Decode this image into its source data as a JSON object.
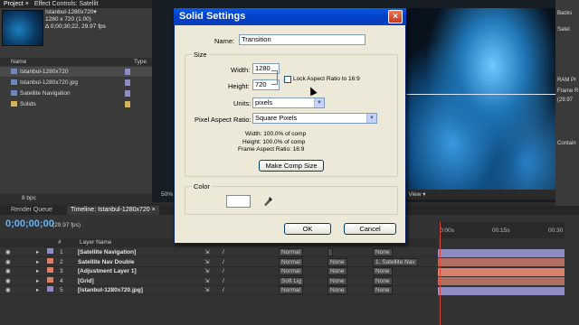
{
  "project_panel": {
    "tabs": [
      "Project ×",
      "Effect Controls: Satellit"
    ],
    "item_title": "Istanbul-1280x720▾",
    "item_size": "1280 x 720 (1.00)",
    "item_duration": "Δ 0;00;30;22, 29.97 fps",
    "column_name": "Name",
    "column_type": "Type",
    "items": [
      {
        "label": "Istanbul-1280x720",
        "icon": "comp-icon",
        "color": "#8e8ec2"
      },
      {
        "label": "Istanbul-1280x720.jpg",
        "icon": "image-icon",
        "color": "#8e8ec2"
      },
      {
        "label": "Satellite Navigation",
        "icon": "comp-icon",
        "color": "#8e8ec2"
      },
      {
        "label": "Solids",
        "icon": "folder-icon",
        "color": "#d2b35a"
      }
    ],
    "bpc": "8 bpc"
  },
  "right_panel": {
    "items": [
      "Backs",
      "Satel",
      "RAM Pr",
      "Frame R",
      "(29.97",
      "Contain"
    ]
  },
  "viewer": {
    "footer_zoom": "50%",
    "footer_view": "1 View ▾"
  },
  "dialog": {
    "title": "Solid Settings",
    "name_label": "Name:",
    "name_value": "Transition",
    "size_group": "Size",
    "width_label": "Width:",
    "width_value": "1280",
    "height_label": "Height:",
    "height_value": "720",
    "lock_label": "Lock Aspect Ratio to 16:9",
    "units_label": "Units:",
    "units_value": "pixels",
    "par_label": "Pixel Aspect Ratio:",
    "par_value": "Square Pixels",
    "info_width": "Width:   100.0% of comp",
    "info_height": "Height:   100.0% of comp",
    "info_far": "Frame Aspect Ratio:  16:9",
    "make_comp_size": "Make Comp Size",
    "color_group": "Color",
    "color_value": "#ffffff",
    "ok": "OK",
    "cancel": "Cancel"
  },
  "timeline": {
    "tabs": [
      "Render Queue",
      "Timeline: Istanbul-1280x720 ×"
    ],
    "timecode": "0;00;00;00",
    "fps": "(29.97 fps)",
    "layer_name_header": "Layer Name",
    "ruler_marks": [
      "0:00s",
      "00:15s",
      "00:30"
    ],
    "layers": [
      {
        "num": "1",
        "name": "[Satellite Navigation]",
        "label_color": "#8e8ec2",
        "mode": "Normal",
        "trkmat": "",
        "parent": "None",
        "bar_color": "#8e8ec2"
      },
      {
        "num": "2",
        "name": "Satellite Nav Double",
        "label_color": "#d9806a",
        "mode": "Normal",
        "trkmat": "None",
        "parent": "1. Satellite Nav",
        "bar_color": "#b36e62"
      },
      {
        "num": "3",
        "name": "[Adjustment Layer 1]",
        "label_color": "#d9806a",
        "mode": "Normal",
        "trkmat": "None",
        "parent": "None",
        "bar_color": "#d9806a"
      },
      {
        "num": "4",
        "name": "[Grid]",
        "label_color": "#d9806a",
        "mode": "Soft Lig",
        "trkmat": "None",
        "parent": "None",
        "bar_color": "#b36e62"
      },
      {
        "num": "5",
        "name": "[Istanbul-1280x720.jpg]",
        "label_color": "#8e8ec2",
        "mode": "Normal",
        "trkmat": "None",
        "parent": "None",
        "bar_color": "#8e8ec2"
      }
    ]
  }
}
